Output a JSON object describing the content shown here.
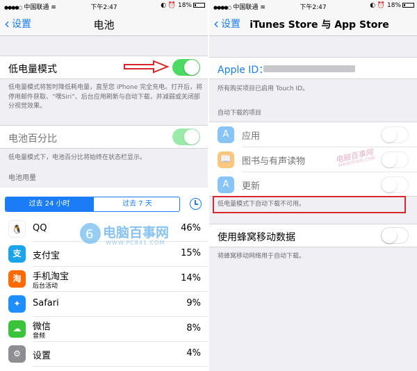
{
  "left_screen": {
    "status": {
      "carrier": "中国联通",
      "time": "下午2:47",
      "battery": "18%",
      "battery_level": 0.18
    },
    "nav": {
      "back": "设置",
      "title": "电池"
    },
    "low_power": {
      "label": "低电量模式",
      "on": true,
      "note": "低电量模式将暂时降低耗电量，直至您 iPhone 完全充电。打开后，将停用邮件获取、“嘿Siri”、后台应用刷新与自动下载，并减弱或关闭部分视觉效果。"
    },
    "battery_pct": {
      "label": "电池百分比",
      "on": true,
      "note": "低电量模式下，电池百分比将始终在状态栏显示。"
    },
    "usage_header": "电池用量",
    "segments": [
      "过去 24 小时",
      "过去 7 天"
    ],
    "apps": [
      {
        "name": "QQ",
        "sub": "",
        "pct": "46%",
        "icon": "qq-icon",
        "color": "#ffffff",
        "glyph": "🐧"
      },
      {
        "name": "支付宝",
        "sub": "",
        "pct": "15%",
        "icon": "alipay-icon",
        "color": "#1aa4ea",
        "glyph": "支"
      },
      {
        "name": "手机淘宝",
        "sub": "后台活动",
        "pct": "14%",
        "icon": "taobao-icon",
        "color": "#ff6a00",
        "glyph": "淘"
      },
      {
        "name": "Safari",
        "sub": "",
        "pct": "9%",
        "icon": "safari-icon",
        "color": "#1f8fff",
        "glyph": "✦"
      },
      {
        "name": "微信",
        "sub": "音频",
        "pct": "8%",
        "icon": "wechat-icon",
        "color": "#3bc43b",
        "glyph": "☁"
      },
      {
        "name": "设置",
        "sub": "",
        "pct": "4%",
        "icon": "settings-gear-icon",
        "color": "#8e8e93",
        "glyph": "⚙"
      }
    ],
    "watermark": {
      "brand": "电脑百事网",
      "url": "WWW.PC841.COM"
    }
  },
  "right_screen": {
    "status": {
      "carrier": "中国联通",
      "time": "下午2:47",
      "battery": "18%",
      "battery_level": 0.18
    },
    "nav": {
      "back": "设置",
      "title": "iTunes Store 与 App Store"
    },
    "apple_id_label": "Apple ID：",
    "touch_id_note": "所有购买项目已启用 Touch ID。",
    "auto_download_header": "自动下载的项目",
    "downloads": [
      {
        "label": "应用",
        "icon": "app-store-icon",
        "color": "#2a94f4",
        "glyph": "A"
      },
      {
        "label": "图书与有声读物",
        "icon": "ibooks-icon",
        "color": "#f79a18",
        "glyph": "📖"
      },
      {
        "label": "更新",
        "icon": "updates-icon",
        "color": "#2a94f4",
        "glyph": "A"
      }
    ],
    "low_power_notice": "低电量模式下自动下载不可用。",
    "cellular": {
      "label": "使用蜂窝移动数据",
      "on": false,
      "note": "将蜂窝移动网络用于自动下载。"
    },
    "watermark": {
      "brand": "电脑百事网",
      "url": "WWW.PC841.COM"
    }
  },
  "colors": {
    "accent": "#1a7cf6",
    "toggle_on": "#4cd964",
    "highlight": "#d9262a"
  }
}
